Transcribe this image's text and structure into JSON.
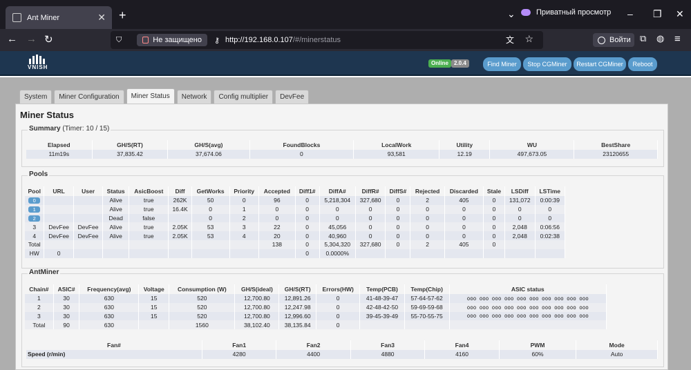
{
  "browser": {
    "tab_title": "Ant Miner",
    "private_label": "Приватный просмотр",
    "security_label": "Не защищено",
    "url_host": "http://192.168.0.107",
    "url_path": "/#/minerstatus",
    "account_label": "Войти"
  },
  "header": {
    "logo_text": "VNISH",
    "status_badge": "Online",
    "version_badge": "2.0.4",
    "buttons": [
      "Find Miner",
      "Stop CGMiner",
      "Restart CGMiner",
      "Reboot"
    ],
    "colors": {
      "header_bg": "#1e3650",
      "button_bg": "#5a9ccd",
      "online": "#4caf50"
    }
  },
  "tabs": [
    "System",
    "Miner Configuration",
    "Miner Status",
    "Network",
    "Config multiplier",
    "DevFee"
  ],
  "active_tab": "Miner Status",
  "page_title": "Miner Status",
  "summary": {
    "title": "Summary",
    "timer": "(Timer: 10 / 15)",
    "headers": [
      "Elapsed",
      "GH/S(RT)",
      "GH/S(avg)",
      "FoundBlocks",
      "LocalWork",
      "Utility",
      "WU",
      "BestShare"
    ],
    "values": [
      "11m19s",
      "37,835.42",
      "37,674.06",
      "0",
      "93,581",
      "12.19",
      "497,673.05",
      "23120655"
    ]
  },
  "pools": {
    "title": "Pools",
    "headers": [
      "Pool",
      "URL",
      "User",
      "Status",
      "AsicBoost",
      "Diff",
      "GetWorks",
      "Priority",
      "Accepted",
      "Diff1#",
      "DiffA#",
      "DiffR#",
      "DiffS#",
      "Rejected",
      "Discarded",
      "Stale",
      "LSDiff",
      "LSTime"
    ],
    "rows": [
      [
        "0",
        "",
        "",
        "Alive",
        "true",
        "262K",
        "50",
        "0",
        "96",
        "0",
        "5,218,304",
        "327,680",
        "0",
        "2",
        "405",
        "0",
        "131,072",
        "0:00:39"
      ],
      [
        "1",
        "",
        "",
        "Alive",
        "true",
        "16.4K",
        "0",
        "1",
        "0",
        "0",
        "0",
        "0",
        "0",
        "0",
        "0",
        "0",
        "0",
        "0"
      ],
      [
        "2",
        "",
        "",
        "Dead",
        "false",
        "",
        "0",
        "2",
        "0",
        "0",
        "0",
        "0",
        "0",
        "0",
        "0",
        "0",
        "0",
        "0"
      ],
      [
        "3",
        "DevFee",
        "DevFee",
        "Alive",
        "true",
        "2.05K",
        "53",
        "3",
        "22",
        "0",
        "45,056",
        "0",
        "0",
        "0",
        "0",
        "0",
        "2,048",
        "0:06:56"
      ],
      [
        "4",
        "DevFee",
        "DevFee",
        "Alive",
        "true",
        "2.05K",
        "53",
        "4",
        "20",
        "0",
        "40,960",
        "0",
        "0",
        "0",
        "0",
        "0",
        "2,048",
        "0:02:38"
      ],
      [
        "Total",
        "",
        "",
        "",
        "",
        "",
        "",
        "",
        "138",
        "0",
        "5,304,320",
        "327,680",
        "0",
        "2",
        "405",
        "0",
        "",
        ""
      ],
      [
        "HW",
        "0",
        "",
        "",
        "",
        "",
        "",
        "",
        "",
        "0",
        "0.0000%",
        "",
        "",
        "",
        "",
        "",
        "",
        ""
      ]
    ]
  },
  "antminer": {
    "title": "AntMiner",
    "headers": [
      "Chain#",
      "ASIC#",
      "Frequency(avg)",
      "Voltage",
      "Consumption (W)",
      "GH/S(ideal)",
      "GH/S(RT)",
      "Errors(HW)",
      "Temp(PCB)",
      "Temp(Chip)",
      "ASIC status"
    ],
    "rows": [
      [
        "1",
        "30",
        "630",
        "15",
        "520",
        "12,700.80",
        "12,891.26",
        "0",
        "41-48-39-47",
        "57-64-57-62",
        "ooo ooo ooo ooo ooo ooo ooo ooo ooo ooo"
      ],
      [
        "2",
        "30",
        "630",
        "15",
        "520",
        "12,700.80",
        "12,247.98",
        "0",
        "42-48-42-50",
        "59-69-59-68",
        "ooo ooo ooo ooo ooo ooo ooo ooo ooo ooo"
      ],
      [
        "3",
        "30",
        "630",
        "15",
        "520",
        "12,700.80",
        "12,996.60",
        "0",
        "39-45-39-49",
        "55-70-55-75",
        "ooo ooo ooo ooo ooo ooo ooo ooo ooo ooo"
      ],
      [
        "Total",
        "90",
        "630",
        "",
        "1560",
        "38,102.40",
        "38,135.84",
        "0",
        "",
        "",
        ""
      ]
    ],
    "fan_headers": [
      "Fan#",
      "Fan1",
      "Fan2",
      "Fan3",
      "Fan4",
      "PWM",
      "Mode"
    ],
    "fan_values": [
      "Speed (r/min)",
      "4280",
      "4400",
      "4880",
      "4160",
      "60%",
      "Auto"
    ]
  }
}
